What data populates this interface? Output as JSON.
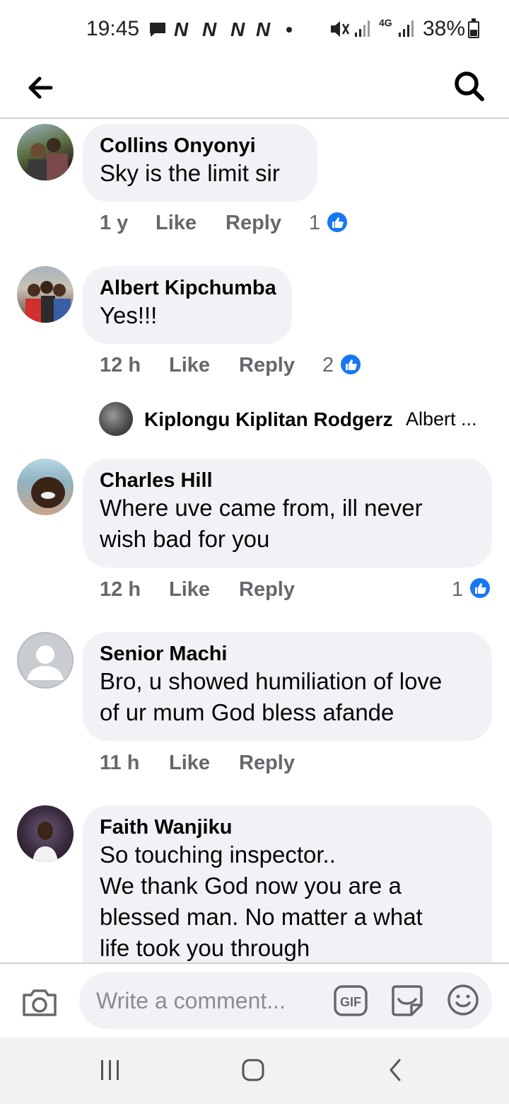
{
  "status_bar": {
    "time": "19:45",
    "battery": "38%",
    "network": "4G",
    "notification_letters": [
      "N",
      "N",
      "N",
      "N"
    ]
  },
  "header": {
    "back_icon": "arrow-left-icon",
    "search_icon": "search-icon"
  },
  "comments": [
    {
      "name": "Collins Onyonyi",
      "text": "Sky is the limit sir",
      "time": "1 y",
      "like_label": "Like",
      "reply_label": "Reply",
      "reactions": "1"
    },
    {
      "name": "Albert Kipchumba",
      "text": "Yes!!!",
      "time": "12 h",
      "like_label": "Like",
      "reply_label": "Reply",
      "reactions": "2"
    },
    {
      "name": "Charles Hill",
      "text": "Where uve came from, ill never\nwish bad for you",
      "time": "12 h",
      "like_label": "Like",
      "reply_label": "Reply",
      "reactions": "1"
    },
    {
      "name": "Senior Machi",
      "text": "Bro, u showed humiliation of love\nof ur mum God bless afande",
      "time": "11 h",
      "like_label": "Like",
      "reply_label": "Reply"
    },
    {
      "name": "Faith Wanjiku",
      "text": "So touching inspector..\nWe thank God now you are a\nblessed man. No matter a what\nlife took you through"
    }
  ],
  "reply_preview": {
    "name": "Kiplongu Kiplitan Rodgerz",
    "snippet": "Albert ..."
  },
  "composer": {
    "placeholder": "Write a comment...",
    "gif_label": "GIF"
  },
  "colors": {
    "bubble": "#f0f2f5",
    "meta_text": "#65676b",
    "like_blue": "#1877f2"
  }
}
